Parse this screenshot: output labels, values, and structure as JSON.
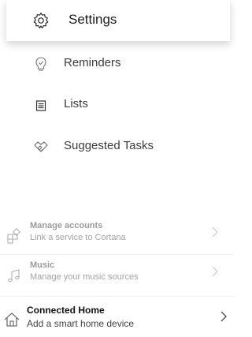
{
  "menu": {
    "settings_label": "Settings",
    "reminders_label": "Reminders",
    "lists_label": "Lists",
    "suggested_tasks_label": "Suggested Tasks"
  },
  "accounts": [
    {
      "title": "Manage accounts",
      "subtitle": "Link a service to Cortana"
    },
    {
      "title": "Music",
      "subtitle": "Manage your music sources"
    },
    {
      "title": "Connected Home",
      "subtitle": "Add a smart home device"
    }
  ]
}
